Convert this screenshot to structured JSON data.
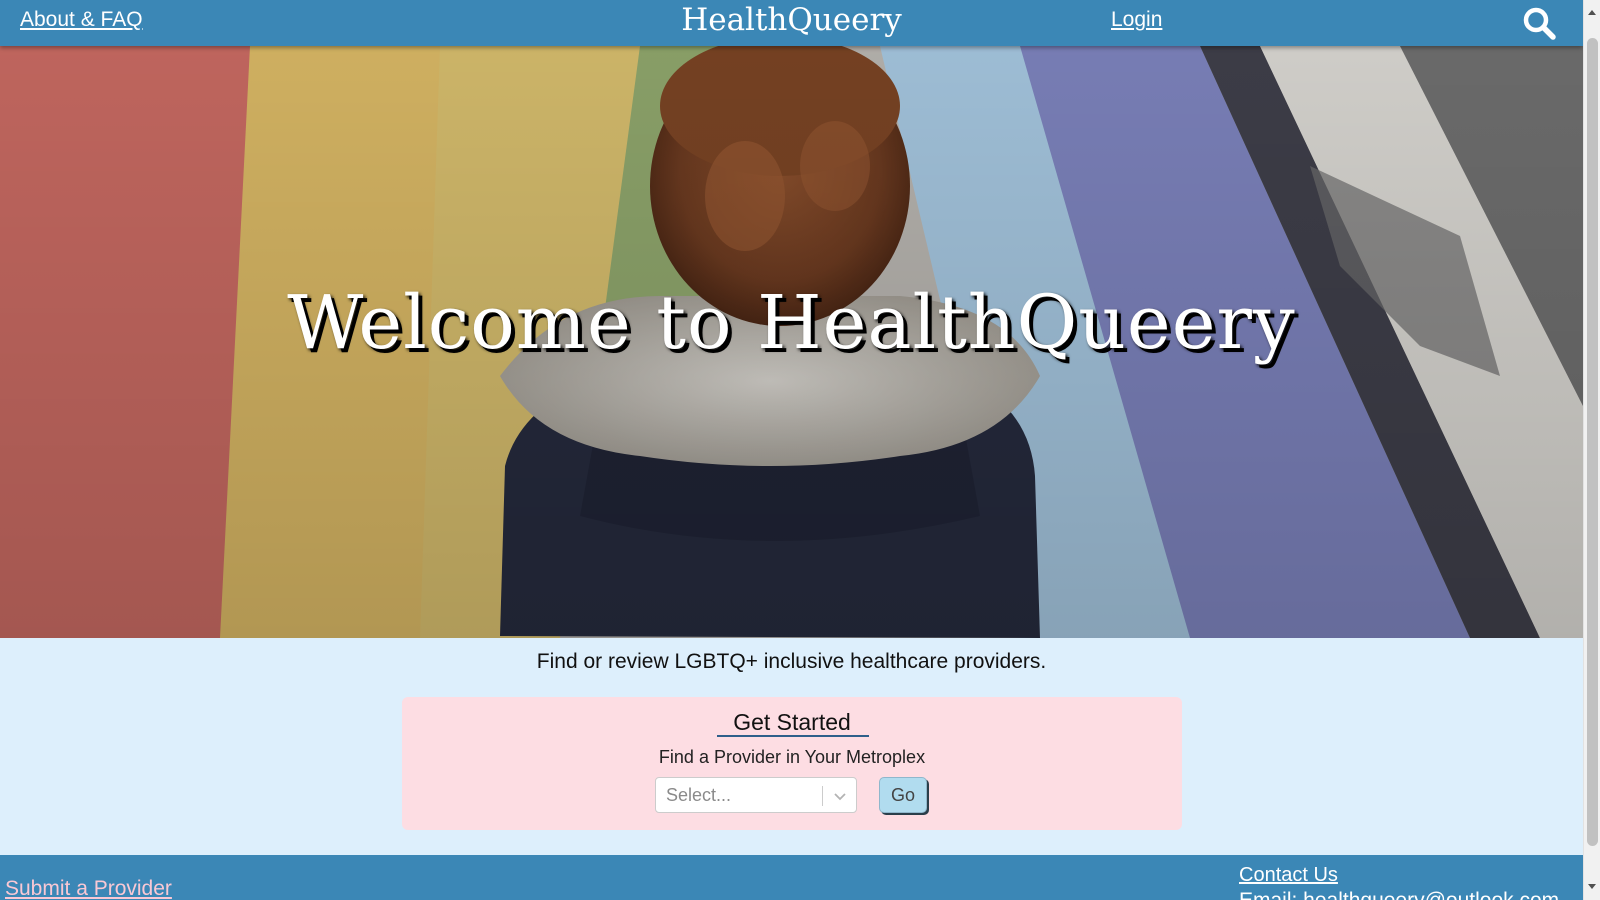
{
  "header": {
    "about_label": "About & FAQ",
    "brand": "HealthQueery",
    "login_label": "Login",
    "search_icon": "search-icon"
  },
  "hero": {
    "title": "Welcome to HealthQueery"
  },
  "main": {
    "tagline": "Find or review LGBTQ+ inclusive healthcare providers."
  },
  "get_started": {
    "title": "Get Started",
    "subtitle": "Find a Provider in Your Metroplex",
    "select_placeholder": "Select...",
    "go_label": "Go"
  },
  "footer": {
    "submit_label": "Submit a Provider",
    "contact_title": "Contact Us",
    "contact_email": "Email: healthqueery@outlook.com"
  },
  "colors": {
    "header_bg": "#3b87b6",
    "page_bg": "#ddeffc",
    "card_bg": "#fddde3",
    "go_button_bg": "#b1dcef",
    "submit_link": "#f9c8d4"
  }
}
